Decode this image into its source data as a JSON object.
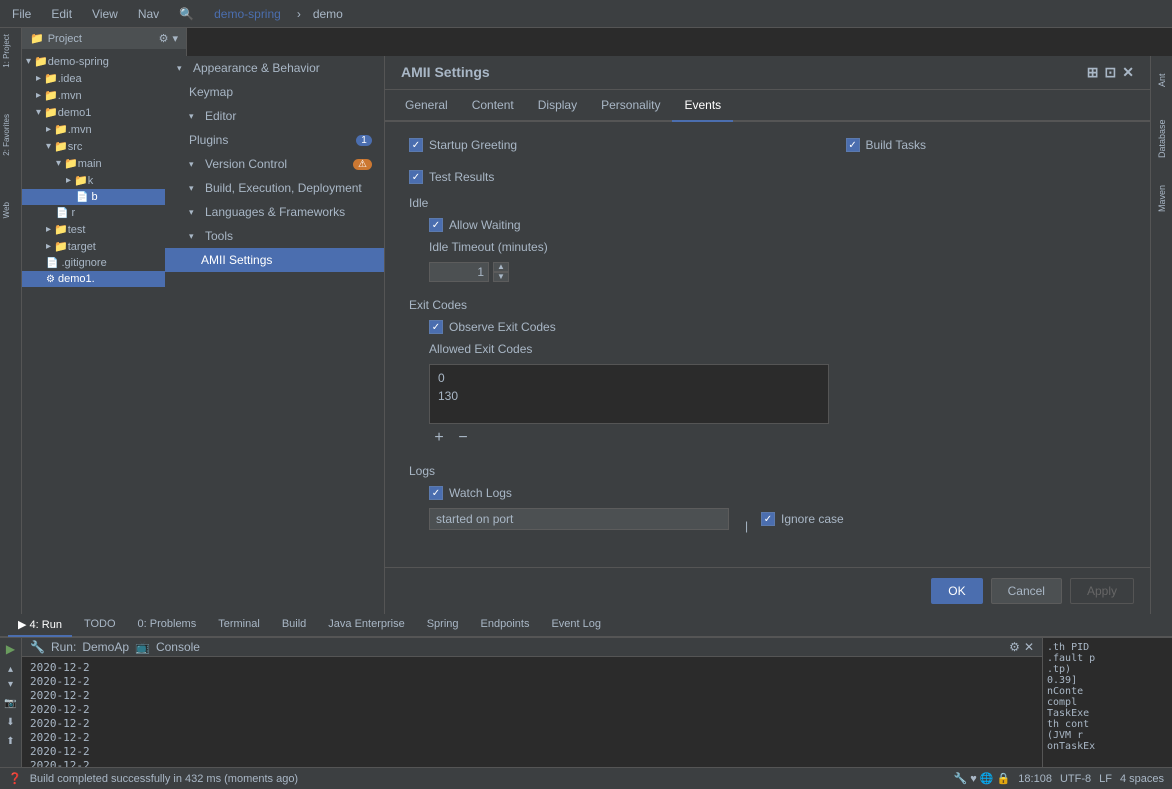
{
  "menubar": {
    "items": [
      "File",
      "Edit",
      "View",
      "Nav"
    ]
  },
  "breadcrumb": {
    "parts": [
      "demo-spring",
      "demo"
    ]
  },
  "sidebar": {
    "title": "Project",
    "tree": [
      {
        "label": "demo-spring",
        "indent": 0,
        "type": "folder",
        "expanded": true
      },
      {
        "label": ".idea",
        "indent": 1,
        "type": "folder"
      },
      {
        "label": ".mvn",
        "indent": 1,
        "type": "folder"
      },
      {
        "label": "demo1",
        "indent": 1,
        "type": "folder",
        "expanded": true
      },
      {
        "label": ".mvn",
        "indent": 2,
        "type": "folder"
      },
      {
        "label": "src",
        "indent": 2,
        "type": "folder",
        "expanded": true
      },
      {
        "label": "main",
        "indent": 3,
        "type": "folder",
        "expanded": true
      },
      {
        "label": "k",
        "indent": 4,
        "type": "folder"
      },
      {
        "label": "b",
        "indent": 5,
        "type": "file"
      },
      {
        "label": "r",
        "indent": 3,
        "type": "file"
      },
      {
        "label": "test",
        "indent": 2,
        "type": "folder"
      },
      {
        "label": "target",
        "indent": 2,
        "type": "folder"
      },
      {
        "label": ".gitignore",
        "indent": 2,
        "type": "file"
      },
      {
        "label": "demo1.",
        "indent": 2,
        "type": "file",
        "selected": true
      }
    ]
  },
  "settings_nav": {
    "title": "AMII Settings",
    "items": [
      {
        "label": "Appearance & Behavior",
        "expandable": true,
        "indent": 0
      },
      {
        "label": "Keymap",
        "indent": 1
      },
      {
        "label": "Editor",
        "expandable": true,
        "indent": 1
      },
      {
        "label": "Plugins",
        "indent": 1,
        "badge": "1"
      },
      {
        "label": "Version Control",
        "expandable": true,
        "indent": 1,
        "badge_type": "orange"
      },
      {
        "label": "Build, Execution, Deployment",
        "expandable": true,
        "indent": 1
      },
      {
        "label": "Languages & Frameworks",
        "expandable": true,
        "indent": 1
      },
      {
        "label": "Tools",
        "expandable": true,
        "indent": 1
      },
      {
        "label": "AMII Settings",
        "indent": 2,
        "active": true
      }
    ]
  },
  "dialog": {
    "title": "AMII Settings",
    "tabs": [
      {
        "label": "General",
        "active": false
      },
      {
        "label": "Content",
        "active": false
      },
      {
        "label": "Display",
        "active": false
      },
      {
        "label": "Personality",
        "active": false
      },
      {
        "label": "Events",
        "active": true
      }
    ],
    "events": {
      "startup_greeting": {
        "label": "Startup Greeting",
        "checked": true
      },
      "build_tasks": {
        "label": "Build Tasks",
        "checked": true
      },
      "test_results": {
        "label": "Test Results",
        "checked": true
      },
      "idle": {
        "title": "Idle",
        "allow_waiting": {
          "label": "Allow Waiting",
          "checked": true
        },
        "timeout_label": "Idle Timeout (minutes)",
        "timeout_value": "1"
      },
      "exit_codes": {
        "title": "Exit Codes",
        "observe": {
          "label": "Observe Exit Codes",
          "checked": true
        },
        "allowed_label": "Allowed Exit Codes",
        "codes": [
          "0",
          "130"
        ],
        "add_icon": "+",
        "remove_icon": "−"
      },
      "logs": {
        "title": "Logs",
        "watch": {
          "label": "Watch Logs",
          "checked": true
        },
        "started_on_port": {
          "placeholder": "started on port",
          "value": "started on port"
        },
        "ignore_case": {
          "label": "Ignore case",
          "checked": true
        }
      }
    }
  },
  "footer_buttons": {
    "ok": "OK",
    "cancel": "Cancel",
    "apply": "Apply"
  },
  "run_bar": {
    "run_label": "Run:",
    "app_name": "DemoAp",
    "tab": "Console",
    "log_lines": [
      "2020-12-2",
      "2020-12-2",
      "2020-12-2",
      "2020-12-2",
      "2020-12-2",
      "2020-12-2",
      "2020-12-2",
      "2020-12-2",
      "2020-12-2"
    ]
  },
  "status_tabs": [
    {
      "label": "4: Run",
      "active": true
    },
    {
      "label": "TODO"
    },
    {
      "label": "0: Problems"
    },
    {
      "label": "Terminal"
    },
    {
      "label": "Build"
    },
    {
      "label": "Java Enterprise"
    },
    {
      "label": "Spring"
    },
    {
      "label": "Endpoints"
    },
    {
      "label": "Event Log"
    }
  ],
  "status_bar": {
    "message": "Build completed successfully in 432 ms (moments ago)",
    "line_col": "18:108",
    "encoding": "UTF-8",
    "indent": "LF",
    "spaces": "4 spaces"
  },
  "right_console_lines": [
    ".th PID",
    ".fault p",
    ".tp)",
    "",
    "0.39]",
    "nConte",
    "compl",
    "TaskExe",
    "th cont",
    "(JVM r",
    "onTaskEx"
  ],
  "left_strip": {
    "items": [
      {
        "label": "1: Project"
      },
      {
        "label": "2: Favorites"
      },
      {
        "label": "Web"
      }
    ]
  },
  "right_strip": {
    "items": [
      {
        "label": "Ant"
      },
      {
        "label": "Database"
      },
      {
        "label": "Maven"
      }
    ]
  }
}
